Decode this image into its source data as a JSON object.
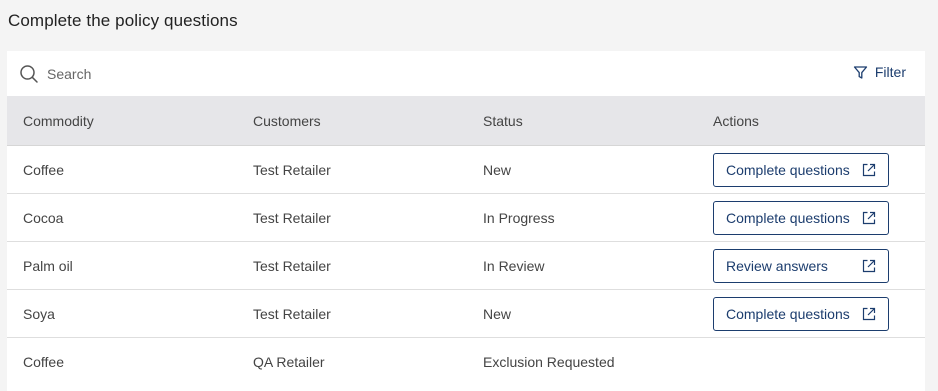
{
  "page": {
    "title": "Complete the policy questions"
  },
  "toolbar": {
    "search_placeholder": "Search",
    "filter_label": "Filter"
  },
  "table": {
    "columns": [
      "Commodity",
      "Customers",
      "Status",
      "Actions"
    ],
    "rows": [
      {
        "commodity": "Coffee",
        "customer": "Test Retailer",
        "status": "New",
        "action": "Complete questions"
      },
      {
        "commodity": "Cocoa",
        "customer": "Test Retailer",
        "status": "In Progress",
        "action": "Complete questions"
      },
      {
        "commodity": "Palm oil",
        "customer": "Test Retailer",
        "status": "In Review",
        "action": "Review answers"
      },
      {
        "commodity": "Soya",
        "customer": "Test Retailer",
        "status": "New",
        "action": "Complete questions"
      },
      {
        "commodity": "Coffee",
        "customer": "QA Retailer",
        "status": "Exclusion Requested",
        "action": ""
      }
    ]
  },
  "colors": {
    "accent": "#1c3d6e",
    "header_bg": "#e6e6e9",
    "page_bg": "#f4f4f4"
  },
  "icons": {
    "search": "search-icon",
    "filter": "filter-icon",
    "external_link": "external-link-icon"
  }
}
